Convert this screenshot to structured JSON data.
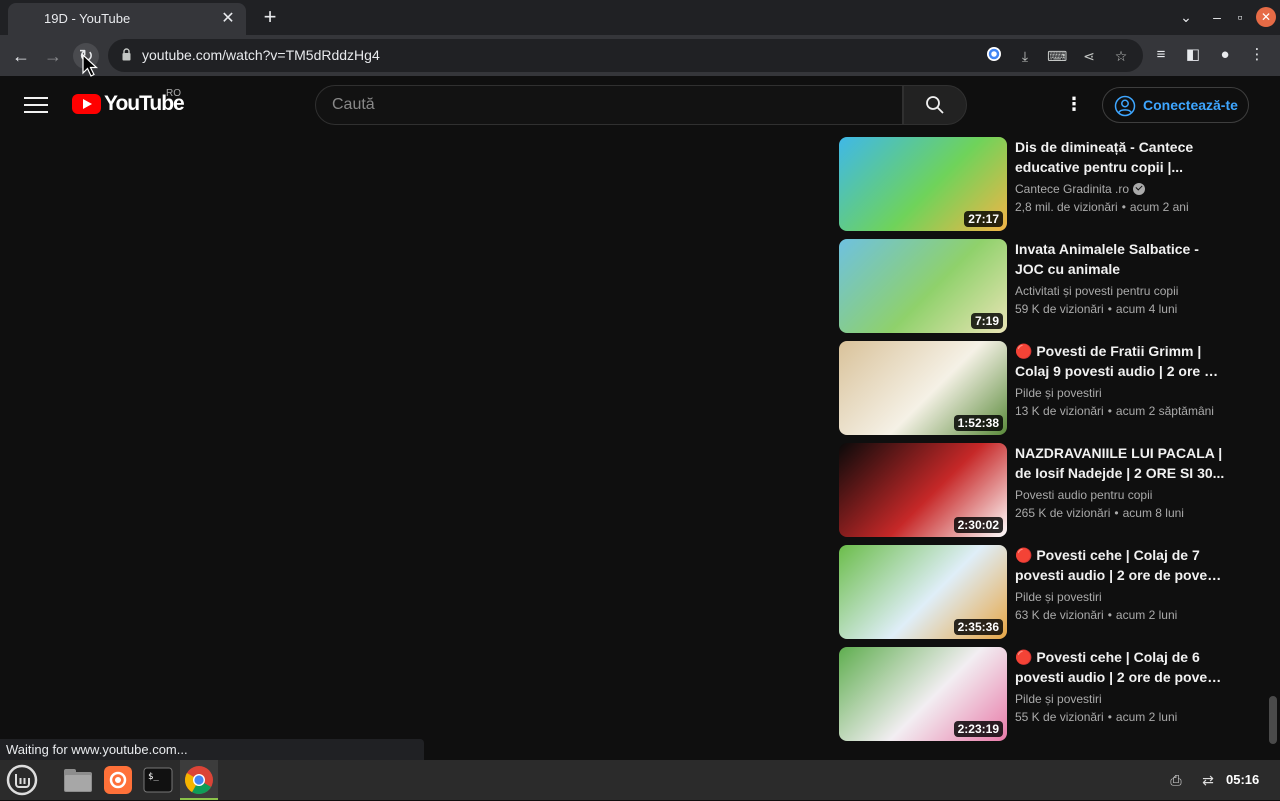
{
  "browser": {
    "tab_title": "19D - YouTube",
    "new_tab": "+",
    "url": "youtube.com/watch?v=TM5dRddzHg4",
    "status_text": "Waiting for www.youtube.com..."
  },
  "youtube": {
    "logo_text": "YouTube",
    "country_code": "RO",
    "search_placeholder": "Caută",
    "signin_label": "Conectează-te"
  },
  "videos": [
    {
      "title_line1": "Dis de dimineață - Cantece",
      "title_line2": "educative pentru copii |...",
      "channel": "Cantece Gradinita .ro",
      "verified": true,
      "views": "2,8 mil. de vizionări",
      "age": "acum 2 ani",
      "duration": "27:17",
      "thumb_colors": [
        "#3fb8e8",
        "#6fd35a",
        "#f3b446"
      ]
    },
    {
      "title_line1": "Invata Animalele Salbatice -",
      "title_line2": "JOC cu animale",
      "channel": "Activitati și povesti pentru copii",
      "verified": false,
      "views": "59 K de vizionări",
      "age": "acum 4 luni",
      "duration": "7:19",
      "thumb_colors": [
        "#6ec1e0",
        "#8fd16b",
        "#e9e4b5"
      ]
    },
    {
      "title_line1": "🔴 Povesti de Fratii Grimm |",
      "title_line2": "Colaj 9 povesti audio | 2 ore de...",
      "channel": "Pilde și povestiri",
      "verified": false,
      "views": "13 K de vizionări",
      "age": "acum 2 săptămâni",
      "duration": "1:52:38",
      "thumb_colors": [
        "#d9c29a",
        "#f5f1e6",
        "#5a8a3a"
      ]
    },
    {
      "title_line1": "NAZDRAVANIILE LUI PACALA |",
      "title_line2": "de Iosif Nadejde | 2 ORE SI 30...",
      "channel": "Povesti audio pentru copii",
      "verified": false,
      "views": "265 K de vizionări",
      "age": "acum 8 luni",
      "duration": "2:30:02",
      "thumb_colors": [
        "#0a0a0a",
        "#c62828",
        "#ffffff"
      ]
    },
    {
      "title_line1": "🔴 Povesti cehe | Colaj de 7",
      "title_line2": "povesti audio | 2 ore de povest...",
      "channel": "Pilde și povestiri",
      "verified": false,
      "views": "63 K de vizionări",
      "age": "acum 2 luni",
      "duration": "2:35:36",
      "thumb_colors": [
        "#6bbd4a",
        "#dfeef8",
        "#e7a645"
      ]
    },
    {
      "title_line1": "🔴 Povesti cehe | Colaj de 6",
      "title_line2": "povesti audio | 2 ore de povest...",
      "channel": "Pilde și povestiri",
      "verified": false,
      "views": "55 K de vizionări",
      "age": "acum 2 luni",
      "duration": "2:23:19",
      "thumb_colors": [
        "#5fae4f",
        "#f2eef2",
        "#e87aa8"
      ]
    }
  ],
  "taskbar": {
    "clock": "05:16"
  }
}
